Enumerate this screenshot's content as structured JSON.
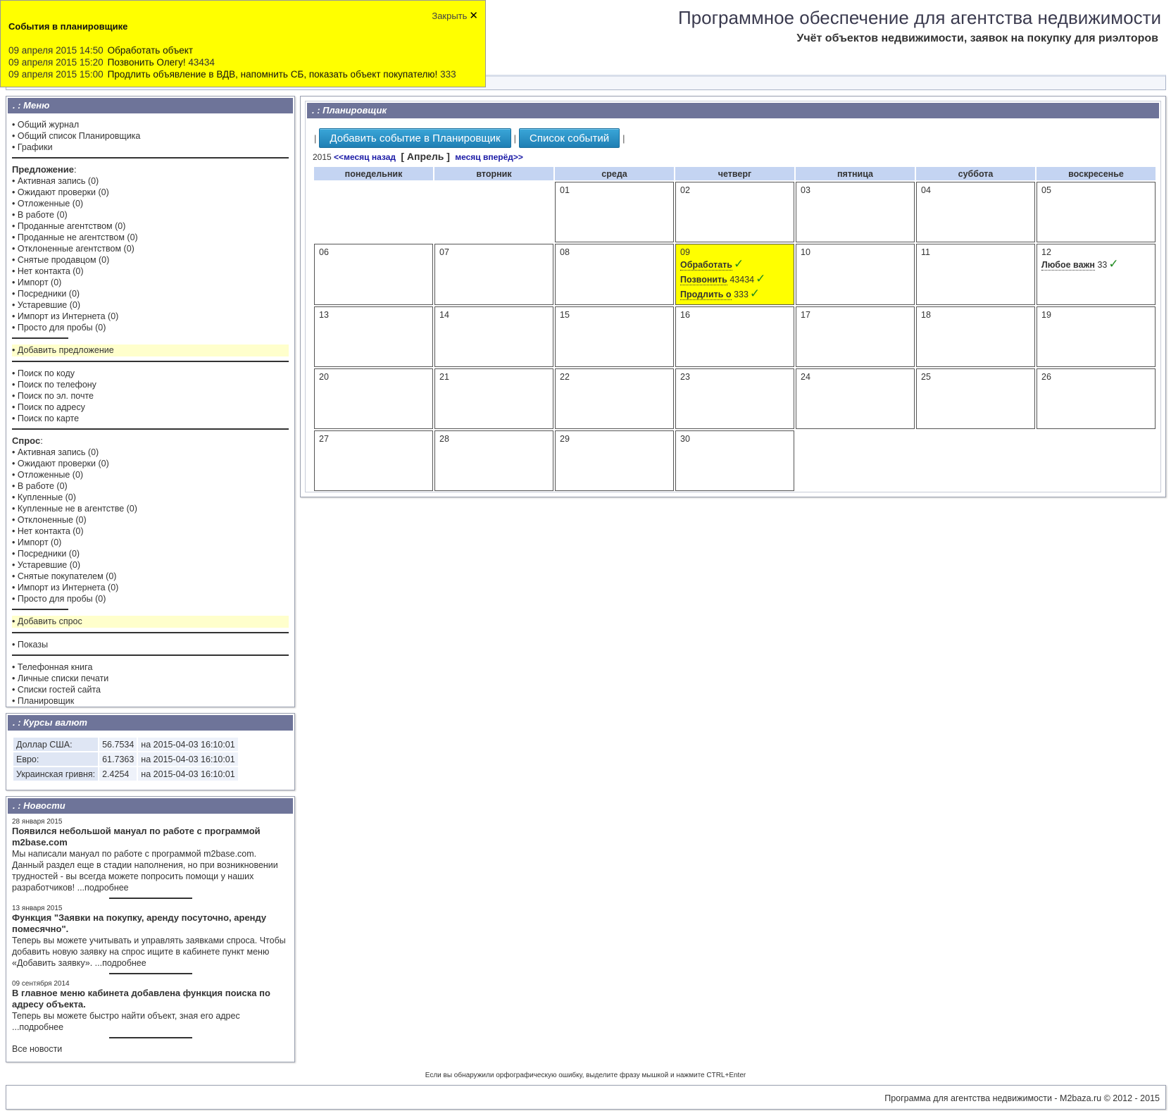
{
  "header": {
    "title": "Программное обеспечение для агентства недвижимости",
    "subtitle": "Учёт объектов недвижимости, заявок на покупку для риэлторов"
  },
  "popup": {
    "title": "События в планировщике",
    "close_label": "Закрыть",
    "events": [
      {
        "datetime": "09 апреля 2015 14:50",
        "text": "Обработать объект",
        "extra": ""
      },
      {
        "datetime": "09 апреля 2015 15:20",
        "text": "Позвонить Олегу!",
        "extra": "43434"
      },
      {
        "datetime": "09 апреля 2015 15:00",
        "text": "Продлить объявление в ВДВ, напомнить СБ, показать объект покупателю!",
        "extra": "333"
      }
    ]
  },
  "menu": {
    "title": ". : Меню",
    "general": [
      "Общий журнал",
      "Общий список Планировщика",
      "Графики"
    ],
    "offer_heading": "Предложение",
    "offer_items": [
      "Активная запись (0)",
      "Ожидают проверки (0)",
      "Отложенные (0)",
      "В работе (0)",
      "Проданные агентством (0)",
      "Проданные не агентством (0)",
      "Отклоненные агентством (0)",
      "Снятые продавцом (0)",
      "Нет контакта (0)",
      "Импорт (0)",
      "Посредники (0)",
      "Устаревшие (0)",
      "Импорт из Интернета (0)",
      "Просто для пробы (0)"
    ],
    "add_offer": "Добавить предложение",
    "search_items": [
      "Поиск по коду",
      "Поиск по телефону",
      "Поиск по эл. почте",
      "Поиск по адресу",
      "Поиск по карте"
    ],
    "demand_heading": "Спрос",
    "demand_items": [
      "Активная запись (0)",
      "Ожидают проверки (0)",
      "Отложенные (0)",
      "В работе (0)",
      "Купленные (0)",
      "Купленные не в агентстве (0)",
      "Отклоненные (0)",
      "Нет контакта (0)",
      "Импорт (0)",
      "Посредники (0)",
      "Устаревшие (0)",
      "Снятые покупателем (0)",
      "Импорт из Интернета (0)",
      "Просто для пробы (0)"
    ],
    "add_demand": "Добавить спрос",
    "shows": "Показы",
    "other_items": [
      "Телефонная книга",
      "Личные списки печати",
      "Списки гостей сайта",
      "Планировщик"
    ]
  },
  "currency": {
    "title": ". : Курсы валют",
    "rows": [
      {
        "name": "Доллар США:",
        "value": "56.7534",
        "date": "на 2015-04-03 16:10:01"
      },
      {
        "name": "Евро:",
        "value": "61.7363",
        "date": "на 2015-04-03 16:10:01"
      },
      {
        "name": "Украинская гривня:",
        "value": "2.4254",
        "date": "на 2015-04-03 16:10:01"
      }
    ]
  },
  "news": {
    "title": ". : Новости",
    "items": [
      {
        "date": "28 января 2015",
        "title": "Появился небольшой мануал по работе с программой m2base.com",
        "text": "Мы написали мануал по работе с программой m2base.com. Данный раздел еще в стадии наполнения, но при возникновении трудностей - вы всегда можете попросить помощи у наших разработчиков! ...подробнее"
      },
      {
        "date": "13 января 2015",
        "title": "Функция \"Заявки на покупку, аренду посуточно, аренду помесячно\".",
        "text": "Теперь вы можете учитывать и управлять заявками спроса. Чтобы добавить новую заявку на спрос ищите в кабинете пункт меню «Добавить заявку». ...подробнее"
      },
      {
        "date": "09 сентября 2014",
        "title": "В главное меню кабинета добавлена функция поиска по адресу объекта.",
        "text": "Теперь вы можете быстро найти объект, зная его адрес ...подробнее"
      }
    ],
    "all_news": "Все новости"
  },
  "planner": {
    "title": ". : Планировщик",
    "add_button": "Добавить событие в Планировщик",
    "list_button": "Список событий",
    "year": "2015",
    "prev_month": "<<месяц назад",
    "current_month": "[ Апрель ]",
    "next_month": "месяц вперёд>>",
    "weekdays": [
      "понедельник",
      "вторник",
      "среда",
      "четверг",
      "пятница",
      "суббота",
      "воскресенье"
    ],
    "weeks": [
      [
        {
          "day": ""
        },
        {
          "day": ""
        },
        {
          "day": "01"
        },
        {
          "day": "02"
        },
        {
          "day": "03"
        },
        {
          "day": "04"
        },
        {
          "day": "05"
        }
      ],
      [
        {
          "day": "06"
        },
        {
          "day": "07"
        },
        {
          "day": "08"
        },
        {
          "day": "09",
          "today": true,
          "events": [
            {
              "title": "Обработать",
              "extra": ""
            },
            {
              "title": "Позвонить",
              "extra": "43434"
            },
            {
              "title": "Продлить о",
              "extra": "333"
            }
          ]
        },
        {
          "day": "10"
        },
        {
          "day": "11"
        },
        {
          "day": "12",
          "events": [
            {
              "title": "Любое важн",
              "extra": "33"
            }
          ]
        }
      ],
      [
        {
          "day": "13"
        },
        {
          "day": "14"
        },
        {
          "day": "15"
        },
        {
          "day": "16"
        },
        {
          "day": "17"
        },
        {
          "day": "18"
        },
        {
          "day": "19"
        }
      ],
      [
        {
          "day": "20"
        },
        {
          "day": "21"
        },
        {
          "day": "22"
        },
        {
          "day": "23"
        },
        {
          "day": "24"
        },
        {
          "day": "25"
        },
        {
          "day": "26"
        }
      ],
      [
        {
          "day": "27"
        },
        {
          "day": "28"
        },
        {
          "day": "29"
        },
        {
          "day": "30"
        },
        {
          "day": "",
          "empty": true
        },
        {
          "day": "",
          "empty": true
        },
        {
          "day": "",
          "empty": true
        }
      ]
    ],
    "check_icon": "check-icon"
  },
  "footer": {
    "note": "Если вы обнаружили орфографическую ошибку, выделите фразу мышкой и нажмите CTRL+Enter",
    "copyright": "Программа для агентства недвижимости - M2baza.ru © 2012 - 2015"
  },
  "colors": {
    "panel_header": "#6e7499",
    "popup_bg": "#ffff00",
    "weekday_header": "#c4d4f2",
    "button": "#1f7fb4",
    "check": "#1f8a1f"
  }
}
